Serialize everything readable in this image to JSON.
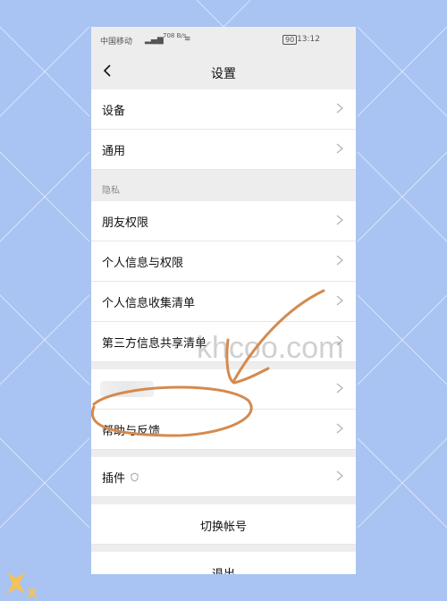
{
  "status_bar": {
    "carrier": "中国移动",
    "speed": "708 B/s",
    "battery": "90",
    "time": "13:12"
  },
  "header": {
    "title": "设置"
  },
  "rows": {
    "device": "设备",
    "general": "通用",
    "privacy_header": "隐私",
    "friend_permissions": "朋友权限",
    "personal_info_permissions": "个人信息与权限",
    "personal_info_list": "个人信息收集清单",
    "third_party_list": "第三方信息共享清单",
    "help_feedback": "帮助与反馈",
    "plugins": "插件",
    "switch_account": "切换帐号",
    "logout": "退出"
  },
  "watermark": "khcoo.com",
  "colors": {
    "outer_background": "#a9c3f2",
    "annotation": "#d48a4f"
  }
}
